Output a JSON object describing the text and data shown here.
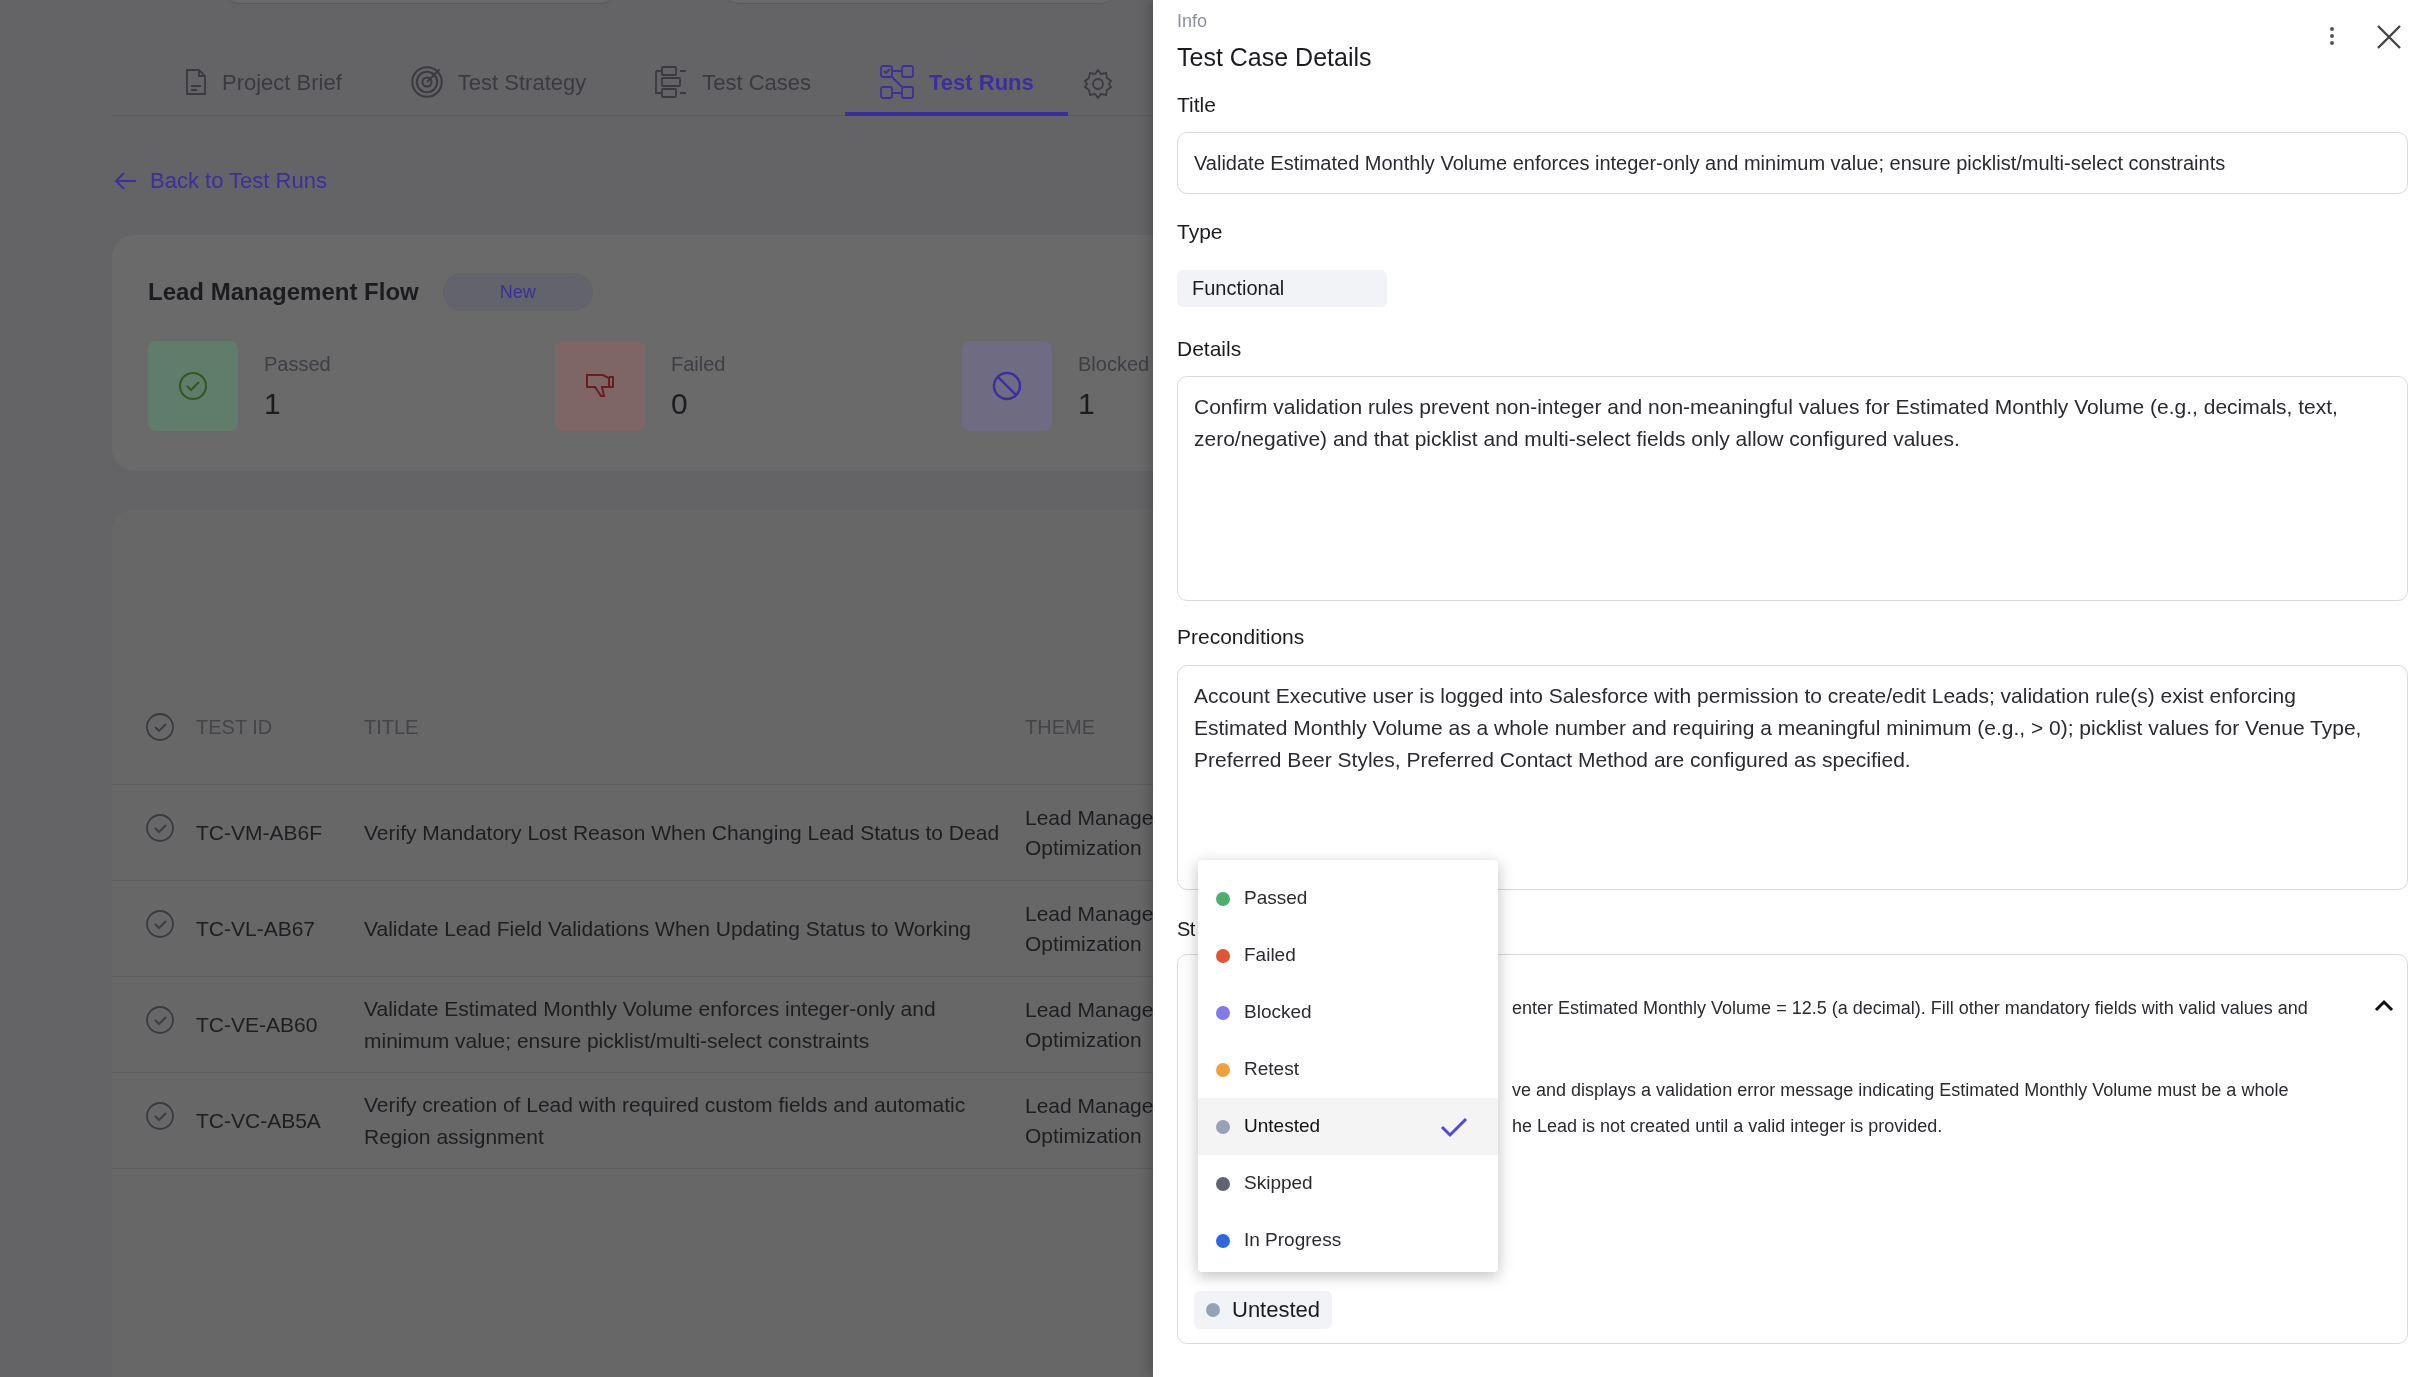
{
  "tabs": [
    {
      "label": "Project Brief",
      "selected": false
    },
    {
      "label": "Test Strategy",
      "selected": false
    },
    {
      "label": "Test Cases",
      "selected": false
    },
    {
      "label": "Test Runs",
      "selected": true
    }
  ],
  "back_link": "Back to Test Runs",
  "run": {
    "title": "Lead Management Flow",
    "status": "New",
    "stats": [
      {
        "kind": "passed",
        "label": "Passed",
        "count": "1"
      },
      {
        "kind": "failed",
        "label": "Failed",
        "count": "0"
      },
      {
        "kind": "blocked",
        "label": "Blocked",
        "count": "1"
      }
    ]
  },
  "table": {
    "columns": [
      "TEST ID",
      "TITLE",
      "THEME"
    ],
    "rows": [
      {
        "id": "TC-VM-AB6F",
        "title": "Verify Mandatory Lost Reason When Changing Lead Status to Dead",
        "theme": [
          "Lead Manage",
          "Optimization"
        ]
      },
      {
        "id": "TC-VL-AB67",
        "title": "Validate Lead Field Validations When Updating Status to Working",
        "theme": [
          "Lead Manage",
          "Optimization"
        ]
      },
      {
        "id": "TC-VE-AB60",
        "title": "Validate Estimated Monthly Volume enforces integer-only and minimum value; ensure picklist/multi-select constraints",
        "theme": [
          "Lead Manage",
          "Optimization"
        ]
      },
      {
        "id": "TC-VC-AB5A",
        "title": "Verify creation of Lead with required custom fields and automatic Region assignment",
        "theme": [
          "Lead Manage",
          "Optimization"
        ]
      }
    ]
  },
  "drawer": {
    "eyebrow": "Info",
    "title": "Test Case Details",
    "title_label": "Title",
    "title_value": "Validate Estimated Monthly Volume enforces integer-only and minimum value; ensure picklist/multi-select constraints",
    "type_label": "Type",
    "type_value": "Functional",
    "details_label": "Details",
    "details_value": "Confirm validation rules prevent non-integer and non-meaningful values for Estimated Monthly Volume (e.g., decimals, text, zero/negative) and that picklist and multi-select fields only allow configured values.",
    "preconditions_label": "Preconditions",
    "preconditions_value": "Account Executive user is logged into Salesforce with permission to create/edit Leads; validation rule(s) exist enforcing Estimated Monthly Volume as a whole number and requiring a meaningful minimum (e.g., > 0); picklist values for Venue Type, Preferred Beer Styles, Preferred Contact Method are configured as specified.",
    "steps_label": "St",
    "step": {
      "expanded": true,
      "action": "enter Estimated Monthly Volume = 12.5 (a decimal). Fill other mandatory fields with valid values and",
      "expected": [
        "ve and displays a validation error message indicating Estimated Monthly Volume must be a whole",
        "he Lead is not created until a valid integer is provided."
      ],
      "status": {
        "label": "Untested",
        "color": "#94a3b8"
      }
    }
  },
  "status_menu": [
    {
      "label": "Passed",
      "color": "#4caf6e",
      "selected": false
    },
    {
      "label": "Failed",
      "color": "#e05634",
      "selected": false
    },
    {
      "label": "Blocked",
      "color": "#8079ea",
      "selected": false
    },
    {
      "label": "Retest",
      "color": "#efa23c",
      "selected": false
    },
    {
      "label": "Untested",
      "color": "#94a3b8",
      "selected": true
    },
    {
      "label": "Skipped",
      "color": "#5f6470",
      "selected": false
    },
    {
      "label": "In Progress",
      "color": "#2f67de",
      "selected": false
    }
  ]
}
